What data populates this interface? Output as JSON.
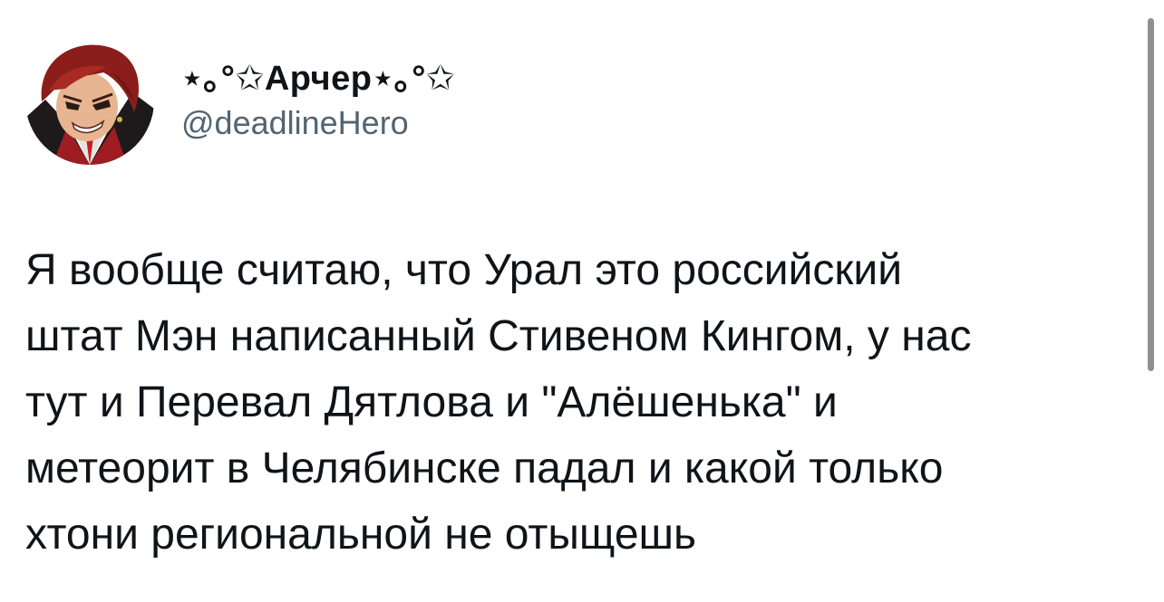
{
  "tweet": {
    "author": {
      "display_name": "⋆｡°✩Арчер⋆｡°✩",
      "handle": "@deadlineHero",
      "avatar_icon": "anime-character-avatar-icon"
    },
    "text_lines": [
      "Я вообще считаю, что Урал это российский",
      "штат Мэн написанный Стивеном Кингом, у нас",
      "тут и Перевал Дятлова и \"Алёшенька\" и",
      "метеорит в Челябинске падал и какой только",
      "хтони региональной не отыщешь"
    ]
  },
  "colors": {
    "text": "#0f1419",
    "secondary_text": "#536471",
    "background": "#ffffff",
    "scrollbar": "#8e8e93"
  }
}
